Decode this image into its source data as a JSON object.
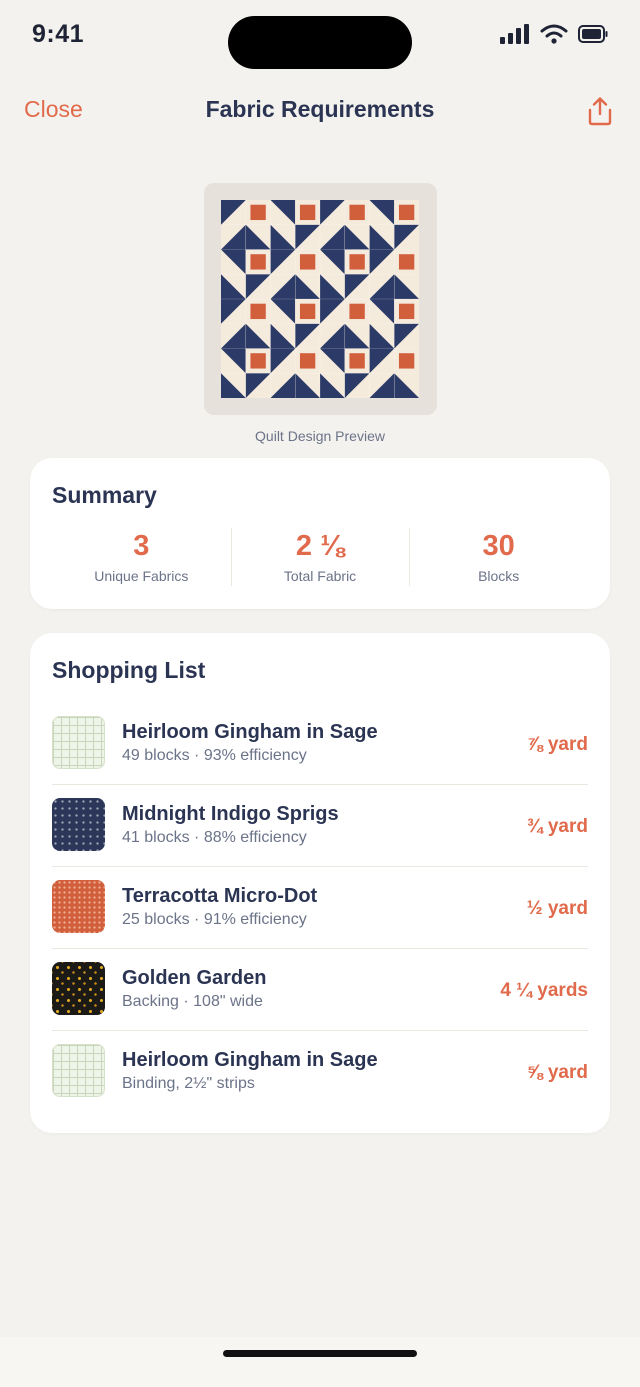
{
  "status": {
    "time": "9:41"
  },
  "nav": {
    "close_label": "Close",
    "title": "Fabric Requirements",
    "share_icon": "share-icon"
  },
  "preview": {
    "caption": "Quilt Design Preview"
  },
  "summary": {
    "title": "Summary",
    "stats": [
      {
        "value": "3",
        "label": "Unique Fabrics"
      },
      {
        "value": "2 ⅛",
        "label": "Total Fabric"
      },
      {
        "value": "30",
        "label": "Blocks"
      }
    ]
  },
  "shopping": {
    "title": "Shopping List",
    "items": [
      {
        "name": "Heirloom Gingham in Sage",
        "detail": "49 blocks · 93% efficiency",
        "amount": "⅞ yard",
        "swatch": "sage-gingham"
      },
      {
        "name": "Midnight Indigo Sprigs",
        "detail": "41 blocks · 88% efficiency",
        "amount": "¾ yard",
        "swatch": "indigo-sprigs"
      },
      {
        "name": "Terracotta Micro-Dot",
        "detail": "25 blocks · 91% efficiency",
        "amount": "½ yard",
        "swatch": "terracotta-dot"
      },
      {
        "name": "Golden Garden",
        "detail": "Backing · 108\" wide",
        "amount": "4 ¼ yards",
        "swatch": "golden-garden"
      },
      {
        "name": "Heirloom Gingham in Sage",
        "detail": "Binding, 2½\" strips",
        "amount": "⅝ yard",
        "swatch": "sage-gingham"
      }
    ]
  },
  "colors": {
    "accent": "#e06a4b",
    "navy": "#2b3553",
    "quilt_navy": "#2b3a66",
    "quilt_cream": "#f5ebdc",
    "quilt_rust": "#d25f3c"
  }
}
